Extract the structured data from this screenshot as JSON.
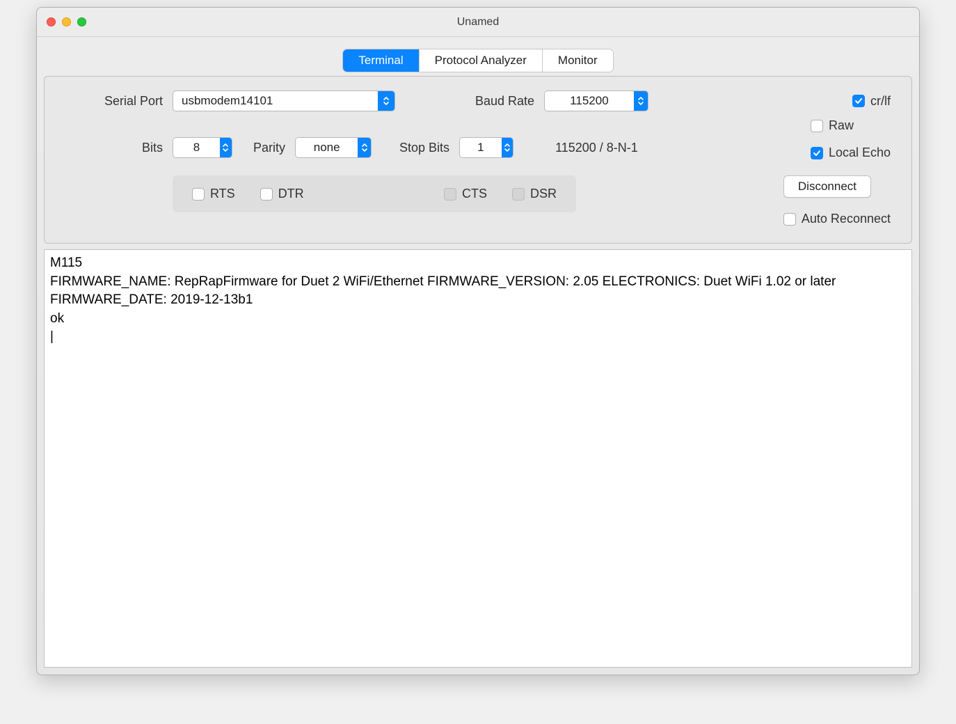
{
  "window": {
    "title": "Unamed"
  },
  "tabs": {
    "items": [
      {
        "label": "Terminal",
        "active": true
      },
      {
        "label": "Protocol Analyzer",
        "active": false
      },
      {
        "label": "Monitor",
        "active": false
      }
    ]
  },
  "serial": {
    "port_label": "Serial Port",
    "port_value": "usbmodem14101",
    "baud_label": "Baud Rate",
    "baud_value": "115200",
    "bits_label": "Bits",
    "bits_value": "8",
    "parity_label": "Parity",
    "parity_value": "none",
    "stopbits_label": "Stop Bits",
    "stopbits_value": "1",
    "status": "115200 / 8-N-1"
  },
  "options": {
    "crlf_label": "cr/lf",
    "crlf_checked": true,
    "raw_label": "Raw",
    "raw_checked": false,
    "localecho_label": "Local Echo",
    "localecho_checked": true
  },
  "signals": {
    "rts_label": "RTS",
    "rts_checked": false,
    "dtr_label": "DTR",
    "dtr_checked": false,
    "cts_label": "CTS",
    "dsr_label": "DSR"
  },
  "actions": {
    "disconnect_label": "Disconnect",
    "autoreconnect_label": "Auto Reconnect",
    "autoreconnect_checked": false
  },
  "terminal": {
    "output": "M115\nFIRMWARE_NAME: RepRapFirmware for Duet 2 WiFi/Ethernet FIRMWARE_VERSION: 2.05 ELECTRONICS: Duet WiFi 1.02 or later FIRMWARE_DATE: 2019-12-13b1\nok"
  }
}
